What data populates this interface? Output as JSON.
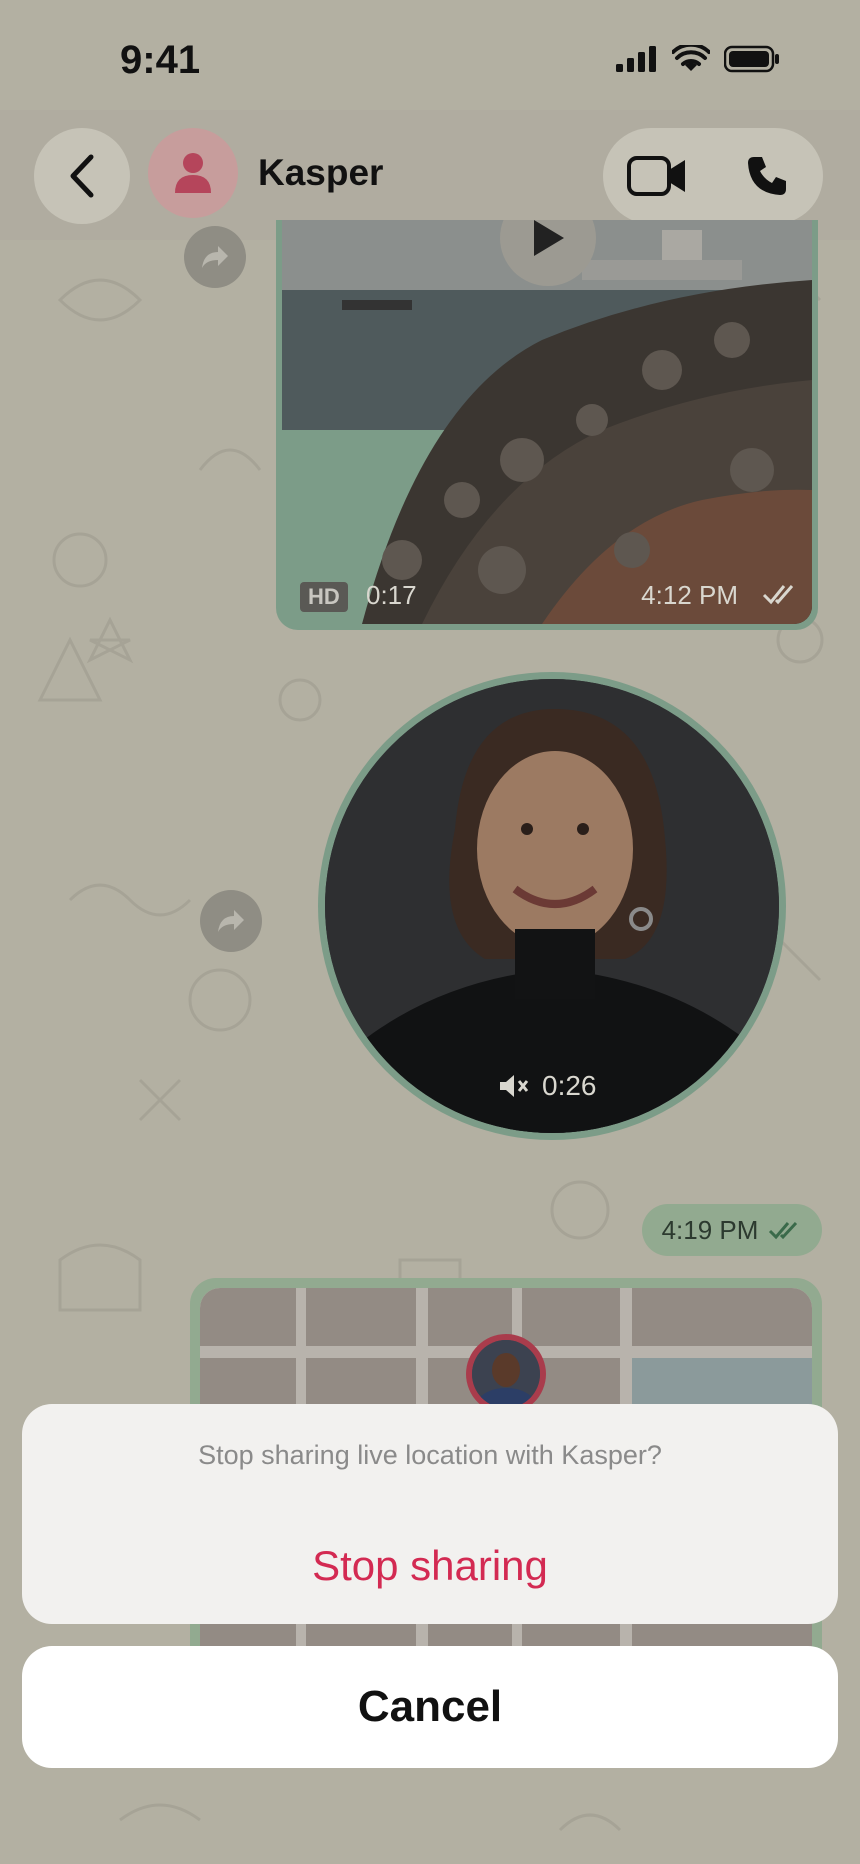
{
  "status_bar": {
    "time": "9:41"
  },
  "header": {
    "contact_name": "Kasper"
  },
  "messages": {
    "video": {
      "hd_badge": "HD",
      "duration": "0:17",
      "time": "4:12 PM"
    },
    "round_video": {
      "duration": "0:26"
    },
    "location": {
      "time": "4:19 PM"
    }
  },
  "action_sheet": {
    "title": "Stop sharing live location with Kasper?",
    "stop_label": "Stop sharing",
    "cancel_label": "Cancel"
  },
  "colors": {
    "destructive": "#d32a52",
    "bubble_outgoing": "#92aa90",
    "avatar_bg": "#c79d9c"
  }
}
